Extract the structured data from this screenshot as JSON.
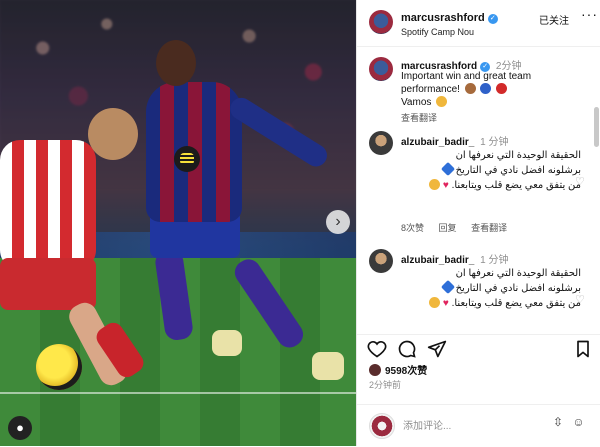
{
  "header": {
    "username": "marcusrashford",
    "location": "Spotify Camp Nou",
    "follow_state": "已关注",
    "more": "···"
  },
  "caption": {
    "username": "marcusrashford",
    "time": "2分钟",
    "text_line1": "Important win and great team",
    "text_line2": "performance!",
    "text_line3": "Vamos",
    "translate": "查看翻译"
  },
  "comments": [
    {
      "username": "alzubair_badir_",
      "time": "1 分钟",
      "line1": "الحقيقة الوحيدة التي نعرفها ان",
      "line2": "برشلونه افضل نادي في التاريخ",
      "line3": "من يتفق معي يضع قلب ويتابعنا.",
      "likes": "8次赞",
      "reply": "回复",
      "translate": "查看翻译"
    },
    {
      "username": "alzubair_badir_",
      "time": "1 分钟",
      "line1": "الحقيقة الوحيدة التي نعرفها ان",
      "line2": "برشلونه افضل نادي في التاريخ",
      "line3": "من يتفق معي يضع قلب ويتابعنا."
    }
  ],
  "post": {
    "likes": "9598次赞",
    "time": "2分钟前"
  },
  "compose": {
    "placeholder": "添加评论..."
  },
  "colors": {
    "verified_blue": "#3897f0",
    "heart_red": "#e0245e",
    "barca_blue": "#1a2a7c",
    "barca_red": "#8a1538"
  },
  "icons": {
    "like": "heart-icon",
    "comment": "comment-icon",
    "share": "send-icon",
    "save": "bookmark-icon",
    "emoji": "smile-icon",
    "more": "more-icon"
  }
}
